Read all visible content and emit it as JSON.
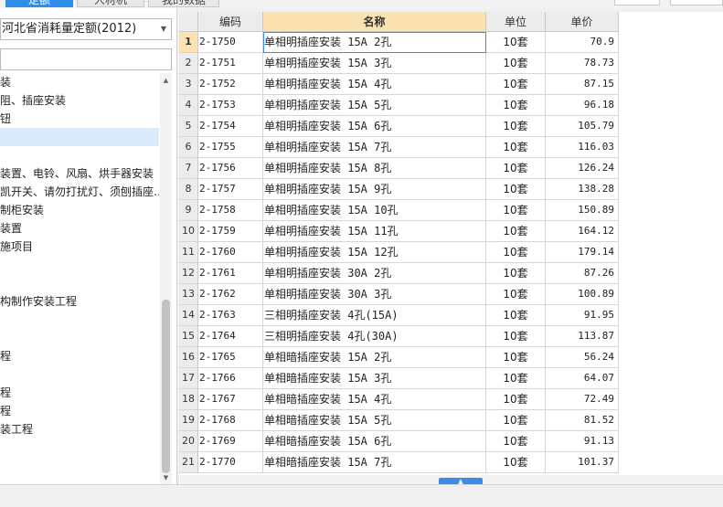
{
  "tabs": [
    "定额",
    "人材机",
    "我的数据"
  ],
  "left": {
    "combo_value": "河北省消耗量定额(2012)",
    "search_placeholder": "",
    "tree": [
      "装",
      "阻、插座安装",
      "钮",
      "",
      "",
      "装置、电铃、风扇、烘手器安装",
      "凯开关、请勿打扰灯、须刨插座…",
      "制柜安装",
      "装置",
      "施项目",
      "",
      "",
      "构制作安装工程",
      "",
      "",
      "程",
      "",
      "程",
      "程",
      "装工程"
    ]
  },
  "grid": {
    "headers": [
      "编码",
      "名称",
      "单位",
      "单价"
    ],
    "rows": [
      {
        "idx": "1",
        "code": "2-1750",
        "name": "单相明插座安装 15A 2孔",
        "unit": "10套",
        "price": "70.9"
      },
      {
        "idx": "2",
        "code": "2-1751",
        "name": "单相明插座安装 15A 3孔",
        "unit": "10套",
        "price": "78.73"
      },
      {
        "idx": "3",
        "code": "2-1752",
        "name": "单相明插座安装 15A 4孔",
        "unit": "10套",
        "price": "87.15"
      },
      {
        "idx": "4",
        "code": "2-1753",
        "name": "单相明插座安装 15A 5孔",
        "unit": "10套",
        "price": "96.18"
      },
      {
        "idx": "5",
        "code": "2-1754",
        "name": "单相明插座安装 15A 6孔",
        "unit": "10套",
        "price": "105.79"
      },
      {
        "idx": "6",
        "code": "2-1755",
        "name": "单相明插座安装 15A 7孔",
        "unit": "10套",
        "price": "116.03"
      },
      {
        "idx": "7",
        "code": "2-1756",
        "name": "单相明插座安装 15A 8孔",
        "unit": "10套",
        "price": "126.24"
      },
      {
        "idx": "8",
        "code": "2-1757",
        "name": "单相明插座安装 15A 9孔",
        "unit": "10套",
        "price": "138.28"
      },
      {
        "idx": "9",
        "code": "2-1758",
        "name": "单相明插座安装 15A 10孔",
        "unit": "10套",
        "price": "150.89"
      },
      {
        "idx": "10",
        "code": "2-1759",
        "name": "单相明插座安装 15A 11孔",
        "unit": "10套",
        "price": "164.12"
      },
      {
        "idx": "11",
        "code": "2-1760",
        "name": "单相明插座安装 15A 12孔",
        "unit": "10套",
        "price": "179.14"
      },
      {
        "idx": "12",
        "code": "2-1761",
        "name": "单相明插座安装 30A 2孔",
        "unit": "10套",
        "price": "87.26"
      },
      {
        "idx": "13",
        "code": "2-1762",
        "name": "单相明插座安装 30A 3孔",
        "unit": "10套",
        "price": "100.89"
      },
      {
        "idx": "14",
        "code": "2-1763",
        "name": "三相明插座安装 4孔(15A)",
        "unit": "10套",
        "price": "91.95"
      },
      {
        "idx": "15",
        "code": "2-1764",
        "name": "三相明插座安装 4孔(30A)",
        "unit": "10套",
        "price": "113.87"
      },
      {
        "idx": "16",
        "code": "2-1765",
        "name": "单相暗插座安装 15A 2孔",
        "unit": "10套",
        "price": "56.24"
      },
      {
        "idx": "17",
        "code": "2-1766",
        "name": "单相暗插座安装 15A 3孔",
        "unit": "10套",
        "price": "64.07"
      },
      {
        "idx": "18",
        "code": "2-1767",
        "name": "单相暗插座安装 15A 4孔",
        "unit": "10套",
        "price": "72.49"
      },
      {
        "idx": "19",
        "code": "2-1768",
        "name": "单相暗插座安装 15A 5孔",
        "unit": "10套",
        "price": "81.52"
      },
      {
        "idx": "20",
        "code": "2-1769",
        "name": "单相暗插座安装 15A 6孔",
        "unit": "10套",
        "price": "91.13"
      },
      {
        "idx": "21",
        "code": "2-1770",
        "name": "单相暗插座安装 15A 7孔",
        "unit": "10套",
        "price": "101.37"
      }
    ]
  },
  "colors": {
    "accent": "#2f8fe8",
    "header_active": "#fbe2b0",
    "selection": "#dcebfb"
  }
}
